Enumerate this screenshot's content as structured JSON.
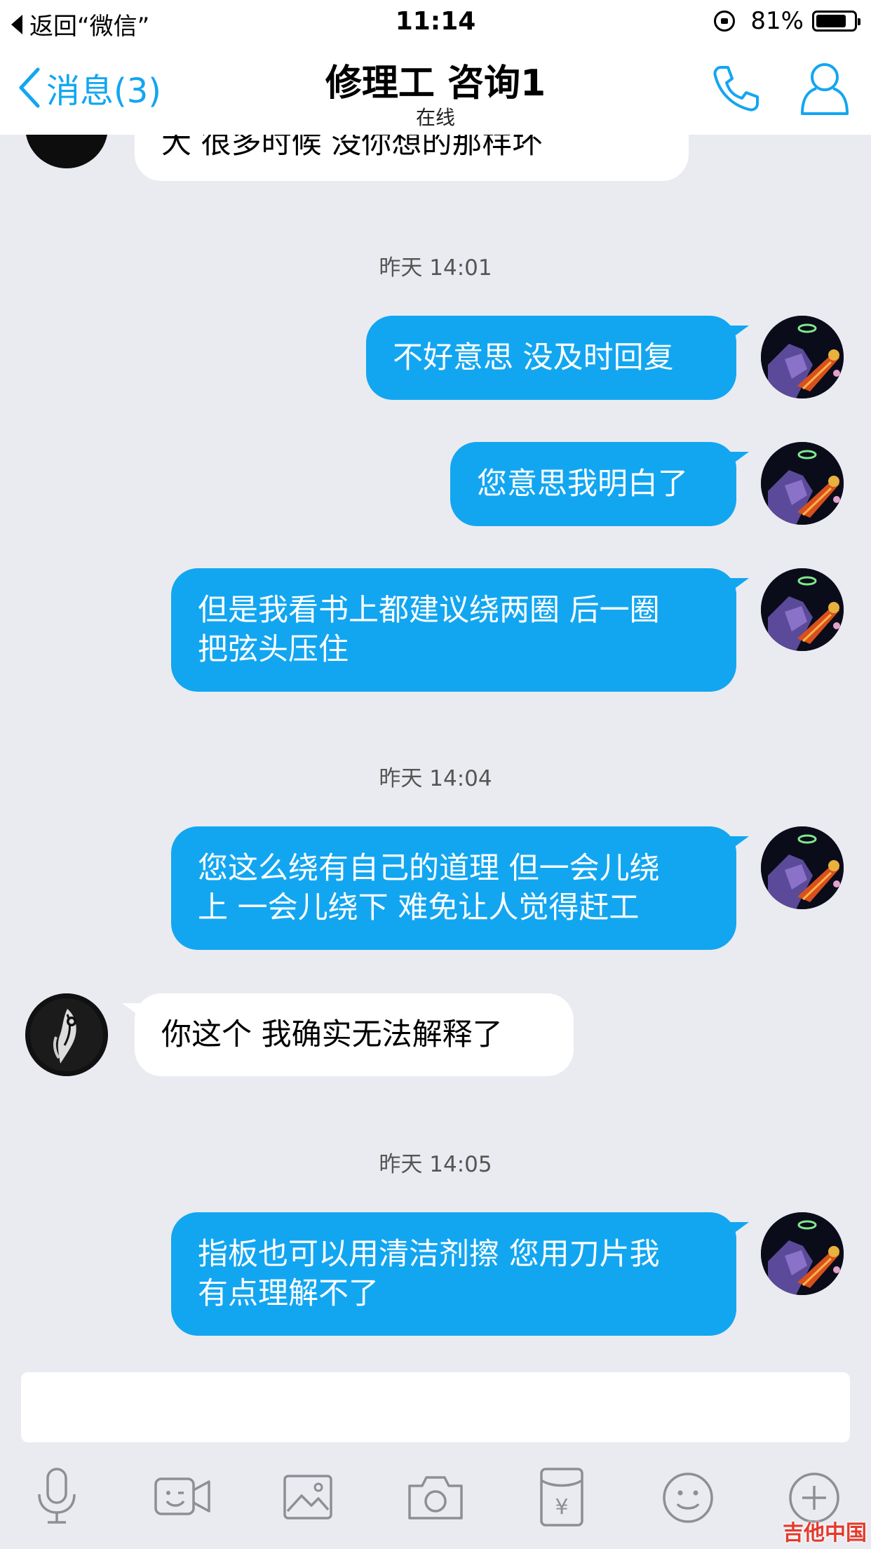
{
  "status_bar": {
    "back_text": "返回“微信”",
    "time": "11:14",
    "battery_text": "81%",
    "battery_level": 0.81
  },
  "nav": {
    "back_label": "消息(3)",
    "title": "修理工 咨询1",
    "subtitle": "在线"
  },
  "chat": {
    "partial_message": "大 很多时候 没你想的那样坏",
    "timestamps": [
      "昨天 14:01",
      "昨天 14:04",
      "昨天 14:05"
    ],
    "messages": [
      {
        "from": "me",
        "lines": [
          "不好意思 没及时回复"
        ]
      },
      {
        "from": "me",
        "lines": [
          "您意思我明白了"
        ]
      },
      {
        "from": "me",
        "lines": [
          "但是我看书上都建议绕两圈 后一圈",
          "把弦头压住"
        ]
      },
      {
        "from": "me",
        "lines": [
          "您这么绕有自己的道理 但一会儿绕",
          "上 一会儿绕下 难免让人觉得赶工"
        ]
      },
      {
        "from": "other",
        "lines": [
          "你这个 我确实无法解释了"
        ]
      },
      {
        "from": "me",
        "lines": [
          "指板也可以用清洁剂擦 您用刀片我",
          "有点理解不了"
        ]
      }
    ]
  },
  "toolbar": {
    "icons": [
      "mic-icon",
      "video-icon",
      "image-icon",
      "camera-icon",
      "red-packet-icon",
      "emoji-icon",
      "plus-icon"
    ],
    "yen_symbol": "¥"
  },
  "watermark": {
    "text": "吉他中国"
  },
  "colors": {
    "accent": "#12a6f1",
    "background": "#eaebf0"
  }
}
